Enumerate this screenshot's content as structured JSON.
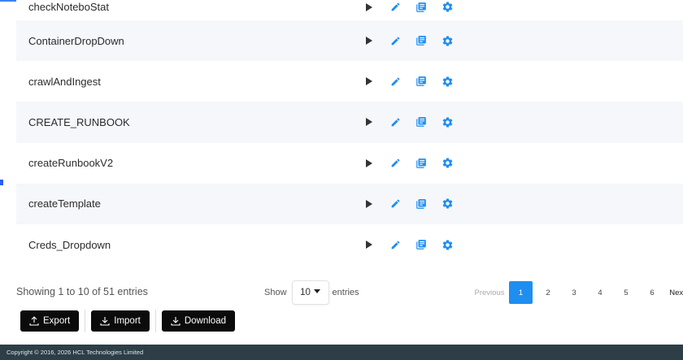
{
  "rows": [
    {
      "name": "checkNoteboStat"
    },
    {
      "name": "ContainerDropDown"
    },
    {
      "name": "crawlAndIngest"
    },
    {
      "name": "CREATE_RUNBOOK"
    },
    {
      "name": "createRunbookV2"
    },
    {
      "name": "createTemplate"
    },
    {
      "name": "Creds_Dropdown"
    }
  ],
  "colors": {
    "accent": "#1f8ef1",
    "play": "#333333",
    "footer_bg": "#2d3e47"
  },
  "icons": {
    "run": "play-icon",
    "edit": "pencil-icon",
    "logs": "document-list-icon",
    "settings": "gear-icon"
  },
  "footer": {
    "showing_text": "Showing 1 to 10 of 51 entries",
    "show_label": "Show",
    "page_size": "10",
    "entries_label": "entries"
  },
  "pagination": {
    "previous": "Previous",
    "pages": [
      "1",
      "2",
      "3",
      "4",
      "5",
      "6"
    ],
    "active": "1",
    "next": "Next"
  },
  "buttons": {
    "export": "Export",
    "import": "Import",
    "download": "Download"
  },
  "copyright": "Copyright © 2016, 2026 HCL Technologies Limited"
}
